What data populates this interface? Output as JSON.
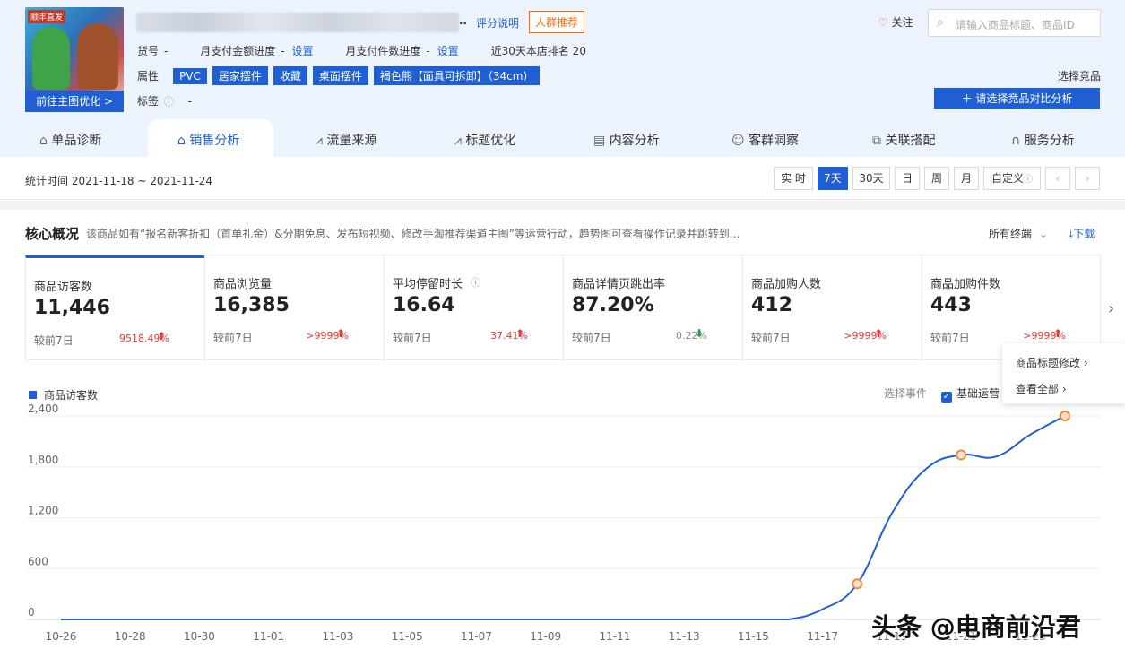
{
  "product": {
    "image_badge": "顺丰直发",
    "optimize_button": "前往主图优化 >",
    "ellipsis": "..",
    "score_link": "评分说明",
    "crowd_button": "人群推荐",
    "sku_label": "货号",
    "sku_value": "-",
    "monthly_amount_label": "月支付金额进度",
    "monthly_amount_value": "-",
    "monthly_amount_link": "设置",
    "monthly_count_label": "月支付件数进度",
    "monthly_count_value": "-",
    "monthly_count_link": "设置",
    "rank_text": "近30天本店排名 20",
    "attr_label": "属性",
    "attrs": [
      "PVC",
      "居家摆件",
      "收藏",
      "桌面摆件",
      "褐色熊【面具可拆卸】（34cm）"
    ],
    "tag_label": "标签",
    "tag_value": "-"
  },
  "header": {
    "follow": "关注",
    "search_placeholder": "请输入商品标题、商品ID",
    "pick_competitor": "选择竞品",
    "compare_button": "请选择竞品对比分析"
  },
  "tabs": [
    {
      "label": "单品诊断",
      "active": false
    },
    {
      "label": "销售分析",
      "active": true
    },
    {
      "label": "流量来源",
      "active": false
    },
    {
      "label": "标题优化",
      "active": false
    },
    {
      "label": "内容分析",
      "active": false
    },
    {
      "label": "客群洞察",
      "active": false
    },
    {
      "label": "关联搭配",
      "active": false
    },
    {
      "label": "服务分析",
      "active": false
    }
  ],
  "date_bar": {
    "range": "统计时间 2021-11-18 ~ 2021-11-24",
    "buttons": [
      {
        "label": "实 时",
        "active": false
      },
      {
        "label": "7天",
        "active": true
      },
      {
        "label": "30天",
        "active": false
      },
      {
        "label": "日",
        "active": false
      },
      {
        "label": "周",
        "active": false
      },
      {
        "label": "月",
        "active": false
      },
      {
        "label": "自定义",
        "active": false
      }
    ],
    "prev": "‹",
    "next": "›"
  },
  "core": {
    "title": "核心概况",
    "desc": "该商品如有“报名新客折扣（首单礼金）&分期免息、发布短视频、修改手淘推荐渠道主图”等运营行动，趋势图可查看操作记录并跳转到...",
    "terminal": "所有终端",
    "download": "下载"
  },
  "metrics": [
    {
      "name": "商品访客数",
      "value": "11,446",
      "cmp": "较前7日",
      "pct": "9518.49%",
      "dir": "up",
      "active": true
    },
    {
      "name": "商品浏览量",
      "value": "16,385",
      "cmp": "较前7日",
      "pct": ">9999%",
      "dir": "up",
      "active": false
    },
    {
      "name": "平均停留时长",
      "value": "16.64",
      "cmp": "较前7日",
      "pct": "37.41%",
      "dir": "up",
      "active": false
    },
    {
      "name": "商品详情页跳出率",
      "value": "87.20%",
      "cmp": "较前7日",
      "pct": "0.22%",
      "dir": "down",
      "active": false
    },
    {
      "name": "商品加购人数",
      "value": "412",
      "cmp": "较前7日",
      "pct": ">9999%",
      "dir": "up",
      "active": false
    },
    {
      "name": "商品加购件数",
      "value": "443",
      "cmp": "较前7日",
      "pct": ">9999%",
      "dir": "up",
      "active": false
    }
  ],
  "popup": {
    "item1": "商品标题修改",
    "item2": "查看全部"
  },
  "chart_controls": {
    "select_event": "选择事件",
    "basic_ops": "基础运营"
  },
  "watermark": "头条 @电商前沿君",
  "colors": {
    "accent": "#1f5fd3",
    "marker": "#f08a3c",
    "up": "#e53935",
    "down": "#1aa04a"
  },
  "chart_data": {
    "type": "line",
    "legend": "商品访客数",
    "x_ticks": [
      "10-26",
      "10-28",
      "10-30",
      "11-01",
      "11-03",
      "11-05",
      "11-07",
      "11-09",
      "11-11",
      "11-13",
      "11-15",
      "11-17",
      "11-19",
      "11-21",
      "11-23"
    ],
    "y_ticks": [
      "0",
      "600",
      "1,200",
      "1,800",
      "2,400"
    ],
    "ylim": [
      0,
      2400
    ],
    "series": [
      {
        "name": "商品访客数",
        "x": [
          "10-26",
          "10-27",
          "10-28",
          "10-29",
          "10-30",
          "10-31",
          "11-01",
          "11-02",
          "11-03",
          "11-04",
          "11-05",
          "11-06",
          "11-07",
          "11-08",
          "11-09",
          "11-10",
          "11-11",
          "11-12",
          "11-13",
          "11-14",
          "11-15",
          "11-16",
          "11-17",
          "11-18",
          "11-19",
          "11-20",
          "11-21",
          "11-22",
          "11-23",
          "11-24"
        ],
        "values": [
          0,
          0,
          0,
          0,
          0,
          0,
          0,
          0,
          0,
          0,
          0,
          0,
          0,
          0,
          0,
          0,
          0,
          0,
          0,
          0,
          0,
          0,
          120,
          420,
          1250,
          1780,
          1940,
          1920,
          2180,
          2400
        ],
        "markers": [
          23,
          26,
          29
        ]
      }
    ]
  }
}
